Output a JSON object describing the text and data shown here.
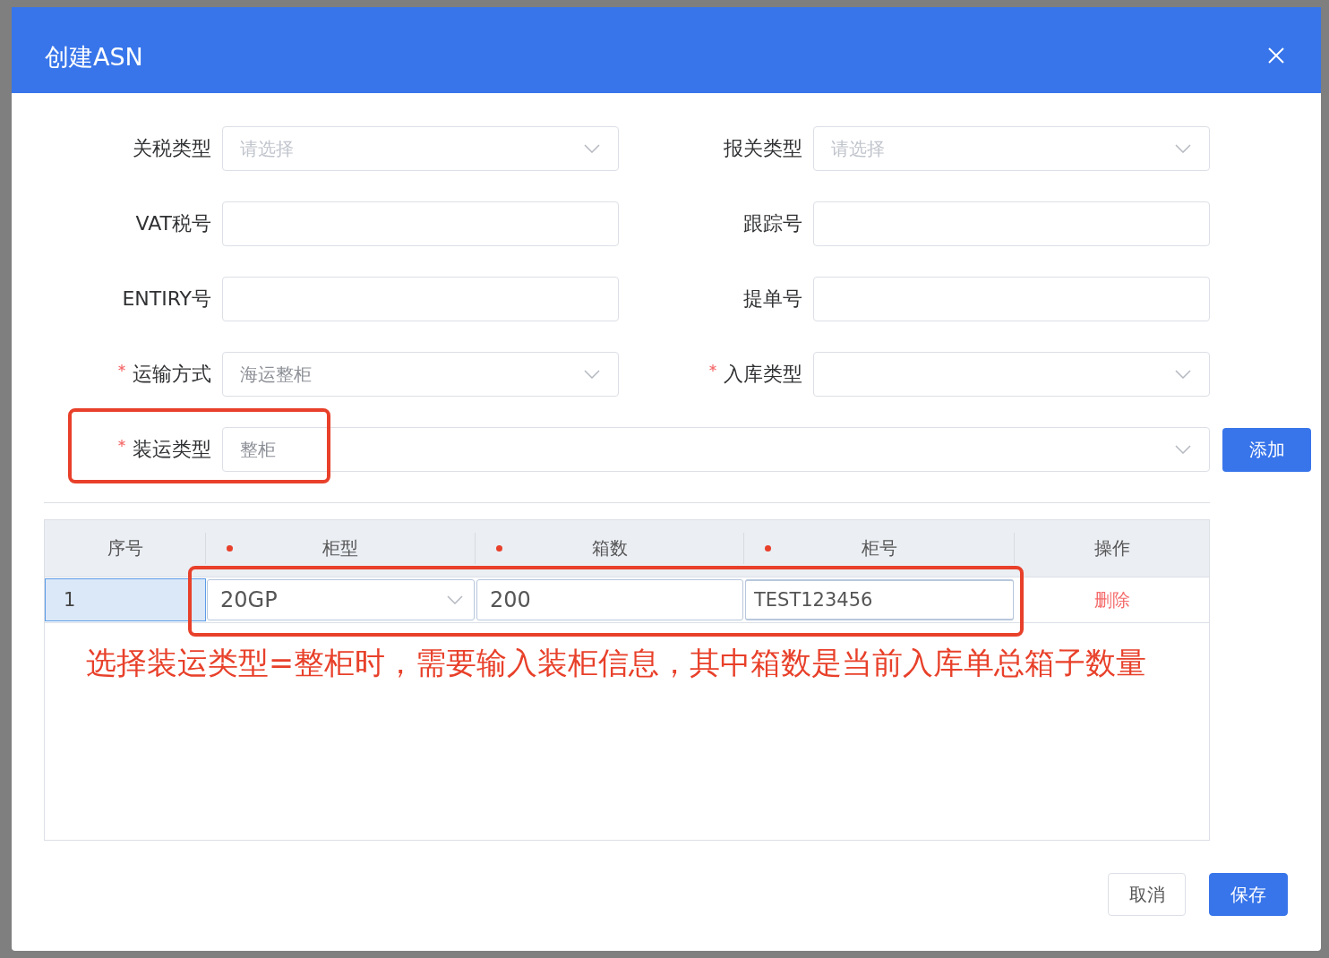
{
  "dialog": {
    "title": "创建ASN"
  },
  "form_rows": [
    [
      {
        "label": "关税类型",
        "kind": "select",
        "placeholder": "请选择",
        "required": false
      },
      {
        "label": "报关类型",
        "kind": "select",
        "placeholder": "请选择",
        "required": false
      }
    ],
    [
      {
        "label": "VAT税号",
        "kind": "input",
        "required": false
      },
      {
        "label": "跟踪号",
        "kind": "input",
        "required": false
      }
    ],
    [
      {
        "label": "ENTIRY号",
        "kind": "input",
        "required": false
      },
      {
        "label": "提单号",
        "kind": "input",
        "required": false
      }
    ],
    [
      {
        "label": "运输方式",
        "kind": "select",
        "value": "海运整柜",
        "required": true
      },
      {
        "label": "入库类型",
        "kind": "select",
        "required": true
      }
    ]
  ],
  "shipping_row": {
    "label": "装运类型",
    "kind": "select",
    "value": "整柜",
    "required": true,
    "add_button": "添加"
  },
  "table": {
    "columns": [
      {
        "label": "序号",
        "required": false
      },
      {
        "label": "柜型",
        "required": true
      },
      {
        "label": "箱数",
        "required": true
      },
      {
        "label": "柜号",
        "required": true
      },
      {
        "label": "操作",
        "required": false
      }
    ],
    "rows": [
      {
        "index": "1",
        "selected": true,
        "container_type": "20GP",
        "box_count": "200",
        "container_no": "TEST123456",
        "action": "删除"
      }
    ]
  },
  "annotation": "选择装运类型=整柜时，需要输入装柜信息，其中箱数是当前入库单总箱子数量",
  "footer_buttons": [
    {
      "label": "取消",
      "kind": "default"
    },
    {
      "label": "保存",
      "kind": "primary"
    }
  ]
}
